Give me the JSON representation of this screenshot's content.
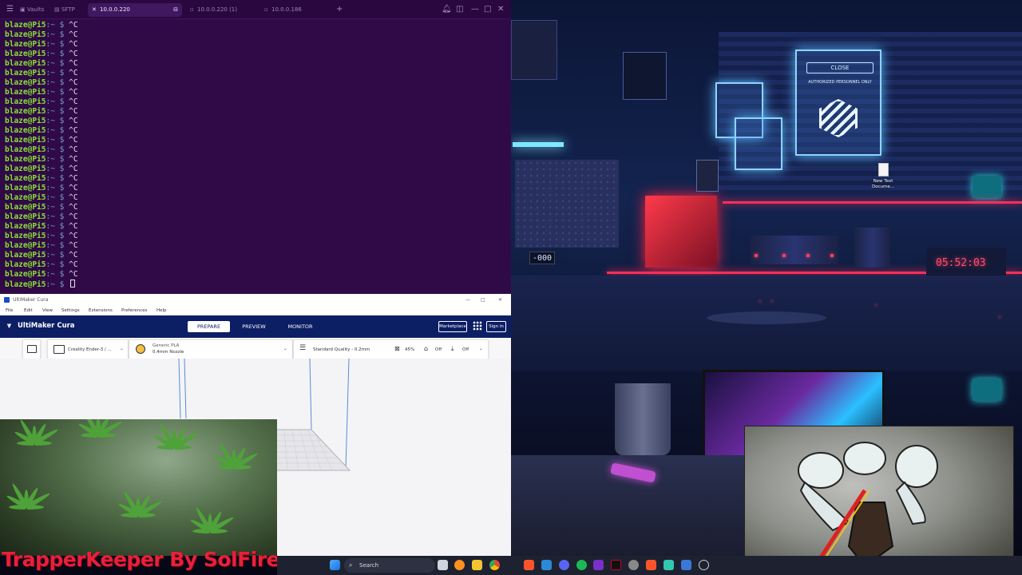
{
  "terminal": {
    "tabs": [
      {
        "label": "Vaults"
      },
      {
        "label": "SFTP"
      },
      {
        "label": "10.0.0.220"
      },
      {
        "label": "10.0.0.220 (1)"
      },
      {
        "label": "10.0.0.186"
      }
    ],
    "new_tab": "+",
    "prompt_user": "blaze@Pi5",
    "prompt_path": ":~ $ ",
    "interrupt": "^C",
    "interrupt_line_count": 27
  },
  "cura": {
    "window_title": "UltiMaker Cura",
    "menu": [
      "File",
      "Edit",
      "View",
      "Settings",
      "Extensions",
      "Preferences",
      "Help"
    ],
    "logo": "UltiMaker Cura",
    "stages": [
      "PREPARE",
      "PREVIEW",
      "MONITOR"
    ],
    "marketplace_label": "Marketplace",
    "signin_label": "Sign in",
    "printer": "Creality Ender-3 / ...",
    "material": "Generic PLA",
    "nozzle": "0.4mm Nozzle",
    "quality": "Standard Quality - 0.2mm",
    "infill": "45%",
    "support": "Off",
    "adhesion": "Off"
  },
  "desktop": {
    "icon_label": "New Text Docume...",
    "clock_red": "05:52:03",
    "clock_small": "-000",
    "sign_close": "CLOSE",
    "sign_text": "AUTHORIZED PERSONNEL ONLY"
  },
  "webcam": {
    "watermark": "TrapperKeeper By SolFire"
  },
  "taskbar": {
    "search_label": "Search"
  }
}
